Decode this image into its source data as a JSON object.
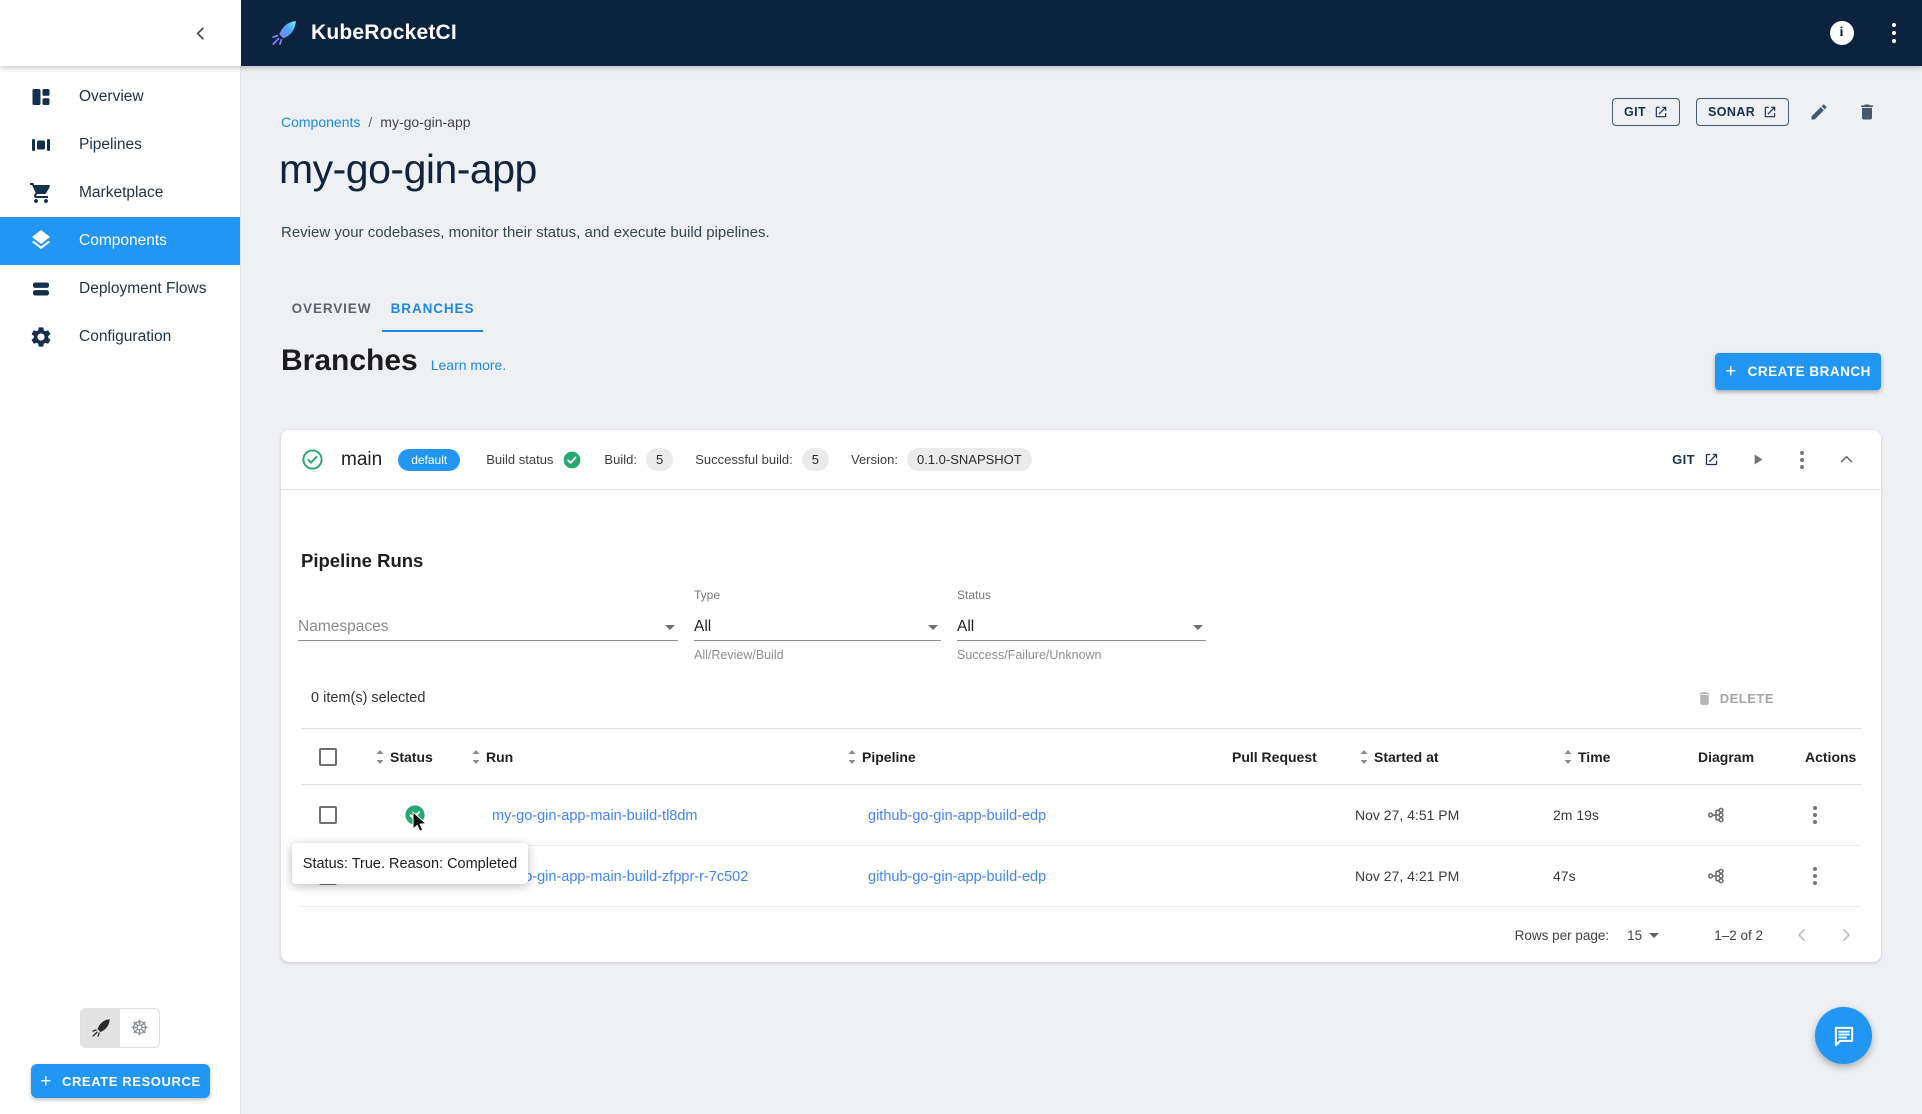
{
  "topbar": {
    "title": "KubeRocketCI"
  },
  "sidebar": {
    "items": [
      {
        "label": "Overview"
      },
      {
        "label": "Pipelines"
      },
      {
        "label": "Marketplace"
      },
      {
        "label": "Components"
      },
      {
        "label": "Deployment Flows"
      },
      {
        "label": "Configuration"
      }
    ],
    "create_resource_label": "CREATE RESOURCE"
  },
  "page": {
    "breadcrumb": {
      "parent": "Components",
      "separator": "/",
      "current": "my-go-gin-app"
    },
    "title": "my-go-gin-app",
    "subtitle": "Review your codebases, monitor their status, and execute build pipelines.",
    "actions": {
      "git_label": "GIT",
      "sonar_label": "SONAR"
    },
    "tabs": [
      {
        "label": "OVERVIEW"
      },
      {
        "label": "BRANCHES"
      }
    ],
    "section_title": "Branches",
    "learn_more_label": "Learn more.",
    "create_branch_label": "CREATE BRANCH"
  },
  "branch": {
    "name": "main",
    "default_chip": "default",
    "build_status_label": "Build status",
    "build_label": "Build:",
    "build_count": "5",
    "successful_build_label": "Successful build:",
    "successful_build_count": "5",
    "version_label": "Version:",
    "version_value": "0.1.0-SNAPSHOT",
    "git_label": "GIT"
  },
  "pipeline_runs": {
    "title": "Pipeline Runs",
    "filters": {
      "namespaces_placeholder": "Namespaces",
      "type_label": "Type",
      "type_value": "All",
      "type_helper": "All/Review/Build",
      "status_label": "Status",
      "status_value": "All",
      "status_helper": "Success/Failure/Unknown"
    },
    "selected_text": "0 item(s) selected",
    "delete_label": "DELETE",
    "table": {
      "columns": [
        "Status",
        "Run",
        "Pipeline",
        "Pull Request",
        "Started at",
        "Time",
        "Diagram",
        "Actions"
      ],
      "rows": [
        {
          "run": "my-go-gin-app-main-build-tl8dm",
          "pipeline": "github-go-gin-app-build-edp",
          "started_at": "Nov 27, 4:51 PM",
          "time": "2m 19s"
        },
        {
          "run": "my-go-gin-app-main-build-zfppr-r-7c502",
          "pipeline": "github-go-gin-app-build-edp",
          "started_at": "Nov 27, 4:21 PM",
          "time": "47s"
        }
      ]
    },
    "pagination": {
      "rows_per_page_label": "Rows per page:",
      "rows_per_page_value": "15",
      "range_text": "1–2 of 2"
    }
  },
  "tooltip": {
    "text": "Status: True. Reason: Completed"
  },
  "colors": {
    "topbar": "#0c2340",
    "accent": "#2196f3",
    "link": "#1e88e5",
    "table_link": "#4285f4",
    "success": "#27a873"
  }
}
